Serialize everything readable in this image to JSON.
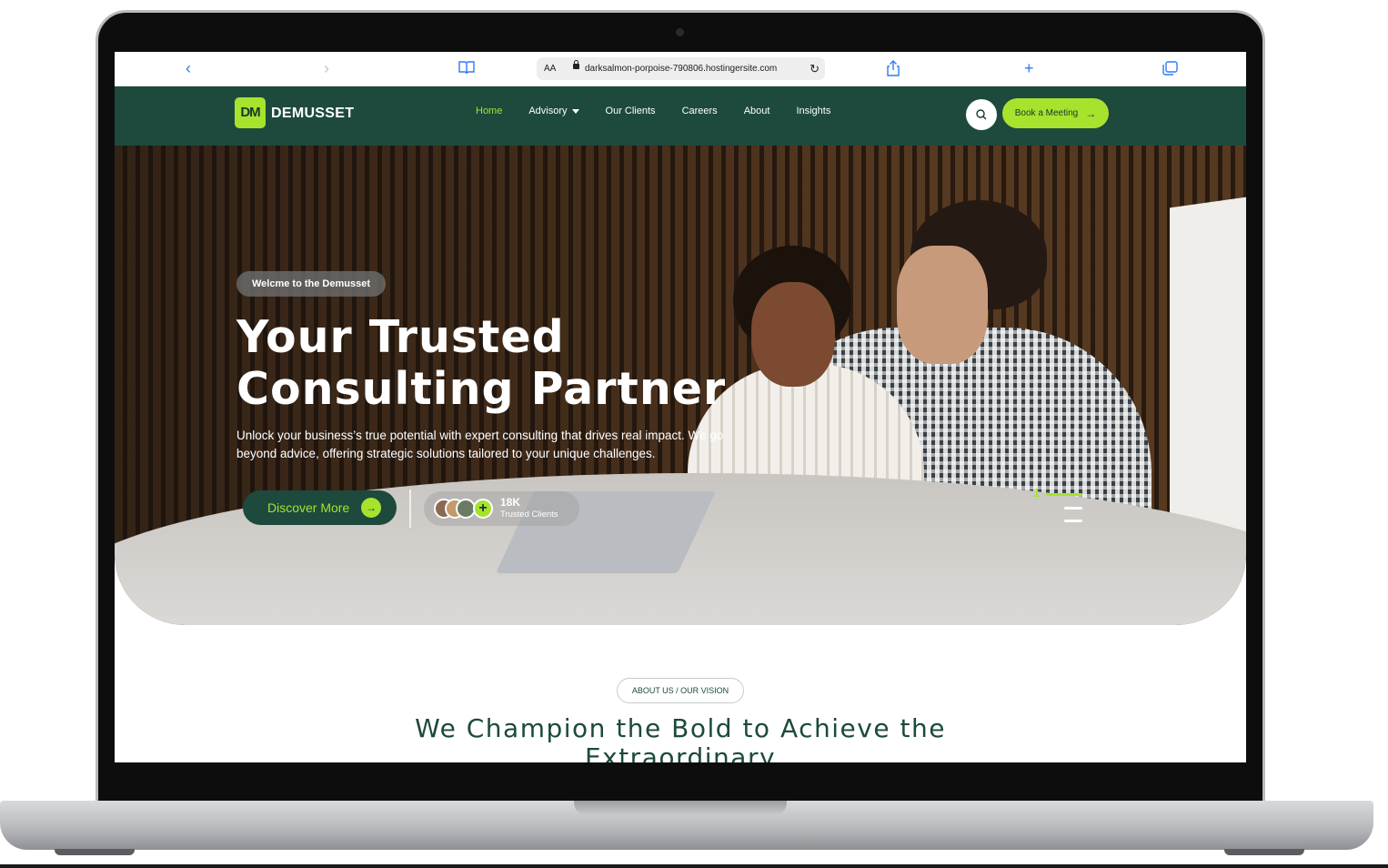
{
  "browser": {
    "text_size_label": "AA",
    "url": "darksalmon-porpoise-790806.hostingersite.com",
    "icons": [
      "back-icon",
      "forward-icon",
      "bookmarks-icon",
      "lock-icon",
      "reload-icon",
      "share-icon",
      "new-tab-icon",
      "tabs-icon"
    ]
  },
  "header": {
    "logo_mark": "DM",
    "logo_text": "DEMUSSET",
    "nav": [
      {
        "label": "Home",
        "active": true
      },
      {
        "label": "Advisory",
        "has_dropdown": true
      },
      {
        "label": "Our Clients"
      },
      {
        "label": "Careers"
      },
      {
        "label": "About"
      },
      {
        "label": "Insights"
      }
    ],
    "book_button": "Book a Meeting",
    "colors": {
      "brand_dark": "#1d4a3d",
      "accent": "#a7e22d"
    }
  },
  "hero": {
    "badge": "Welcme to the Demusset",
    "title": "Your Trusted Consulting Partner",
    "description": "Unlock your business’s true potential with expert consulting that drives real impact. We go beyond advice, offering strategic solutions tailored to your unique challenges.",
    "cta": "Discover More",
    "clients_count": "18K",
    "clients_label": "Trusted Clients",
    "slide_number": "1"
  },
  "about": {
    "eyebrow": "ABOUT US / OUR VISION",
    "title": "We Champion the Bold to Achieve the Extraordinary"
  }
}
